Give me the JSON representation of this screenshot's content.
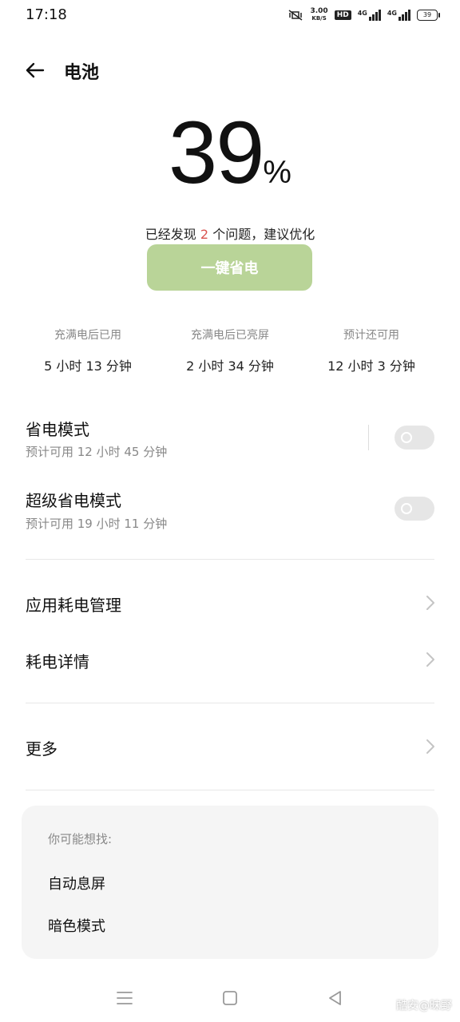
{
  "status_bar": {
    "time": "17:18",
    "speed_value": "3.00",
    "speed_unit": "KB/S",
    "hd": "HD",
    "sim1": "4G",
    "sim2": "4G",
    "battery": "39"
  },
  "header": {
    "title": "电池"
  },
  "battery": {
    "percent": "39",
    "percent_sign": "%",
    "issue_prefix": "已经发现",
    "issue_count": "2",
    "issue_suffix": "个问题，建议优化",
    "optimize_label": "一键省电"
  },
  "stats": [
    {
      "label": "充满电后已用",
      "value": "5 小时 13 分钟"
    },
    {
      "label": "充满电后已亮屏",
      "value": "2 小时 34 分钟"
    },
    {
      "label": "预计还可用",
      "value": "12 小时 3 分钟"
    }
  ],
  "modes": [
    {
      "title": "省电模式",
      "subtitle": "预计可用 12 小时 45 分钟",
      "enabled": false
    },
    {
      "title": "超级省电模式",
      "subtitle": "预计可用 19 小时 11 分钟",
      "enabled": false
    }
  ],
  "menu": [
    {
      "label": "应用耗电管理"
    },
    {
      "label": "耗电详情"
    },
    {
      "label": "更多"
    }
  ],
  "suggestions": {
    "title": "你可能想找:",
    "items": [
      "自动息屏",
      "暗色模式"
    ]
  },
  "watermark": "酷安@昧野",
  "colors": {
    "accent_green": "#b9d498",
    "issue_red": "#d9534f",
    "toggle_off": "#e6e6e6"
  }
}
